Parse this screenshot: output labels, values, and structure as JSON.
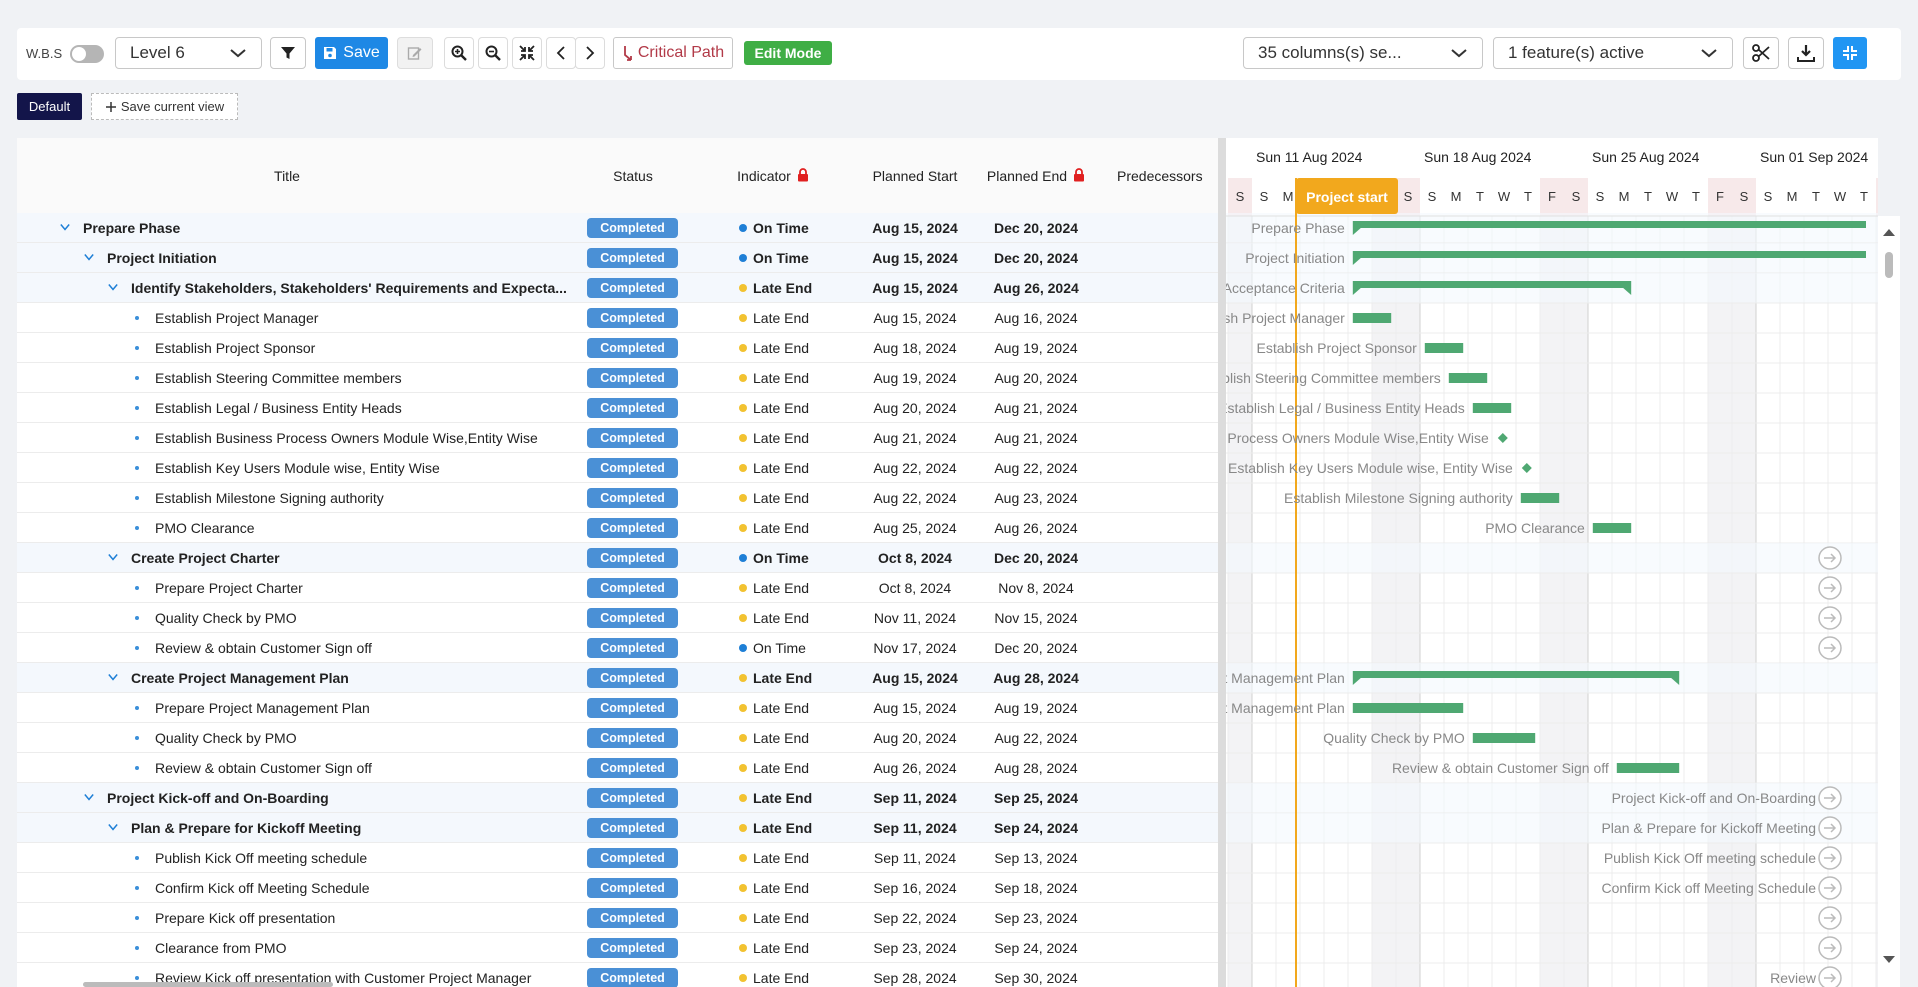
{
  "toolbar": {
    "wbs_label": "W.B.S",
    "level_select": "Level 6",
    "save_label": "Save",
    "critical_path_label": "Critical Path",
    "edit_mode_label": "Edit Mode",
    "columns_select": "35 columns(s) se...",
    "features_select": "1 feature(s) active"
  },
  "views": {
    "default_label": "Default",
    "save_view_label": "Save current view"
  },
  "columns": {
    "title": "Title",
    "status": "Status",
    "indicator": "Indicator",
    "planned_start": "Planned Start",
    "planned_end": "Planned End",
    "predecessors": "Predecessors"
  },
  "colors": {
    "on_time": "#1e7fd6",
    "late_end": "#f2c230",
    "bar": "#4fa872",
    "project_start": "#f2a81d",
    "badge": "#4a90d6"
  },
  "rows": [
    {
      "level": 0,
      "parent": true,
      "title": "Prepare Phase",
      "status": "Completed",
      "indicator": "On Time",
      "start": "Aug 15, 2024",
      "end": "Dec 20, 2024",
      "gantt_label": "Prepare Phase"
    },
    {
      "level": 1,
      "parent": true,
      "title": "Project Initiation",
      "status": "Completed",
      "indicator": "On Time",
      "start": "Aug 15, 2024",
      "end": "Dec 20, 2024",
      "gantt_label": "Project Initiation"
    },
    {
      "level": 2,
      "parent": true,
      "title": "Identify Stakeholders, Stakeholders' Requirements and Expecta...",
      "status": "Completed",
      "indicator": "Late End",
      "start": "Aug 15, 2024",
      "end": "Aug 26, 2024",
      "gantt_label": "Acceptance Criteria"
    },
    {
      "level": 3,
      "parent": false,
      "title": "Establish Project Manager",
      "status": "Completed",
      "indicator": "Late End",
      "start": "Aug 15, 2024",
      "end": "Aug 16, 2024",
      "gantt_label": "Establish Project Manager"
    },
    {
      "level": 3,
      "parent": false,
      "title": "Establish Project Sponsor",
      "status": "Completed",
      "indicator": "Late End",
      "start": "Aug 18, 2024",
      "end": "Aug 19, 2024",
      "gantt_label": "Establish Project Sponsor"
    },
    {
      "level": 3,
      "parent": false,
      "title": "Establish Steering Committee members",
      "status": "Completed",
      "indicator": "Late End",
      "start": "Aug 19, 2024",
      "end": "Aug 20, 2024",
      "gantt_label": "Establish Steering Committee members"
    },
    {
      "level": 3,
      "parent": false,
      "title": "Establish Legal / Business Entity Heads",
      "status": "Completed",
      "indicator": "Late End",
      "start": "Aug 20, 2024",
      "end": "Aug 21, 2024",
      "gantt_label": "Establish Legal / Business Entity Heads"
    },
    {
      "level": 3,
      "parent": false,
      "title": "Establish Business Process Owners Module Wise,Entity Wise",
      "status": "Completed",
      "indicator": "Late End",
      "start": "Aug 21, 2024",
      "end": "Aug 21, 2024",
      "gantt_label": "Establish Business Process Owners Module Wise,Entity Wise"
    },
    {
      "level": 3,
      "parent": false,
      "title": "Establish Key Users Module wise, Entity Wise",
      "status": "Completed",
      "indicator": "Late End",
      "start": "Aug 22, 2024",
      "end": "Aug 22, 2024",
      "gantt_label": "Establish Key Users Module wise, Entity Wise"
    },
    {
      "level": 3,
      "parent": false,
      "title": "Establish Milestone Signing authority",
      "status": "Completed",
      "indicator": "Late End",
      "start": "Aug 22, 2024",
      "end": "Aug 23, 2024",
      "gantt_label": "Establish Milestone Signing authority"
    },
    {
      "level": 3,
      "parent": false,
      "title": "PMO Clearance",
      "status": "Completed",
      "indicator": "Late End",
      "start": "Aug 25, 2024",
      "end": "Aug 26, 2024",
      "gantt_label": "PMO Clearance"
    },
    {
      "level": 2,
      "parent": true,
      "title": "Create Project Charter",
      "status": "Completed",
      "indicator": "On Time",
      "start": "Oct 8, 2024",
      "end": "Dec 20, 2024",
      "gantt_label": ""
    },
    {
      "level": 3,
      "parent": false,
      "title": "Prepare Project Charter",
      "status": "Completed",
      "indicator": "Late End",
      "start": "Oct 8, 2024",
      "end": "Nov 8, 2024",
      "gantt_label": ""
    },
    {
      "level": 3,
      "parent": false,
      "title": "Quality Check by PMO",
      "status": "Completed",
      "indicator": "Late End",
      "start": "Nov 11, 2024",
      "end": "Nov 15, 2024",
      "gantt_label": ""
    },
    {
      "level": 3,
      "parent": false,
      "title": "Review & obtain Customer Sign off",
      "status": "Completed",
      "indicator": "On Time",
      "start": "Nov 17, 2024",
      "end": "Dec 20, 2024",
      "gantt_label": ""
    },
    {
      "level": 2,
      "parent": true,
      "title": "Create Project Management Plan",
      "status": "Completed",
      "indicator": "Late End",
      "start": "Aug 15, 2024",
      "end": "Aug 28, 2024",
      "gantt_label": "Create Project Management Plan"
    },
    {
      "level": 3,
      "parent": false,
      "title": "Prepare Project Management Plan",
      "status": "Completed",
      "indicator": "Late End",
      "start": "Aug 15, 2024",
      "end": "Aug 19, 2024",
      "gantt_label": "Prepare Project Management Plan"
    },
    {
      "level": 3,
      "parent": false,
      "title": "Quality Check by PMO",
      "status": "Completed",
      "indicator": "Late End",
      "start": "Aug 20, 2024",
      "end": "Aug 22, 2024",
      "gantt_label": "Quality Check by PMO"
    },
    {
      "level": 3,
      "parent": false,
      "title": "Review & obtain Customer Sign off",
      "status": "Completed",
      "indicator": "Late End",
      "start": "Aug 26, 2024",
      "end": "Aug 28, 2024",
      "gantt_label": "Review & obtain Customer Sign off"
    },
    {
      "level": 1,
      "parent": true,
      "title": "Project Kick-off and On-Boarding",
      "status": "Completed",
      "indicator": "Late End",
      "start": "Sep 11, 2024",
      "end": "Sep 25, 2024",
      "gantt_label": "Project Kick-off and On-Boarding"
    },
    {
      "level": 2,
      "parent": true,
      "title": "Plan & Prepare for Kickoff Meeting",
      "status": "Completed",
      "indicator": "Late End",
      "start": "Sep 11, 2024",
      "end": "Sep 24, 2024",
      "gantt_label": "Plan & Prepare for Kickoff Meeting"
    },
    {
      "level": 3,
      "parent": false,
      "title": "Publish Kick Off meeting schedule",
      "status": "Completed",
      "indicator": "Late End",
      "start": "Sep 11, 2024",
      "end": "Sep 13, 2024",
      "gantt_label": "Publish Kick Off meeting schedule"
    },
    {
      "level": 3,
      "parent": false,
      "title": "Confirm Kick off Meeting Schedule",
      "status": "Completed",
      "indicator": "Late End",
      "start": "Sep 16, 2024",
      "end": "Sep 18, 2024",
      "gantt_label": "Confirm Kick off Meeting Schedule"
    },
    {
      "level": 3,
      "parent": false,
      "title": "Prepare Kick off presentation",
      "status": "Completed",
      "indicator": "Late End",
      "start": "Sep 22, 2024",
      "end": "Sep 23, 2024",
      "gantt_label": ""
    },
    {
      "level": 3,
      "parent": false,
      "title": "Clearance from PMO",
      "status": "Completed",
      "indicator": "Late End",
      "start": "Sep 23, 2024",
      "end": "Sep 24, 2024",
      "gantt_label": ""
    },
    {
      "level": 3,
      "parent": false,
      "title": "Review Kick off presentation with Customer Project Manager",
      "status": "Completed",
      "indicator": "Late End",
      "start": "Sep 28, 2024",
      "end": "Sep 30, 2024",
      "gantt_label": "Review"
    }
  ],
  "gantt": {
    "weeks": [
      "Sun 11 Aug 2024",
      "Sun 18 Aug 2024",
      "Sun 25 Aug 2024",
      "Sun 01 Sep 2024"
    ],
    "first_day": "Aug 10, 2024",
    "project_start_label": "Project start",
    "project_start_date": "Aug 14, 2024",
    "day_letters": [
      "S",
      "S",
      "M",
      "T",
      "W",
      "T",
      "F",
      "S",
      "S",
      "M",
      "T",
      "W",
      "T",
      "F",
      "S",
      "S",
      "M",
      "T",
      "W",
      "T",
      "F",
      "S",
      "S",
      "M",
      "T",
      "W",
      "T",
      "F"
    ]
  }
}
